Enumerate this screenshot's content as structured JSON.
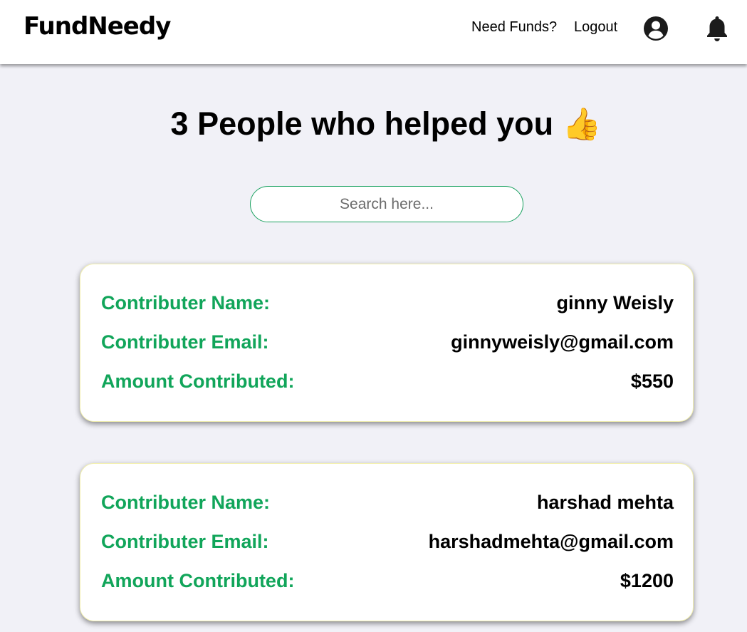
{
  "header": {
    "logo": "FundNeedy",
    "links": [
      "Need Funds?",
      "Logout"
    ],
    "icons": [
      "account-circle-icon",
      "bell-icon"
    ]
  },
  "main": {
    "title": "3 People who helped you",
    "title_emoji": "👍",
    "search": {
      "placeholder": "Search here...",
      "value": ""
    },
    "labels": {
      "name": "Contributer Name:",
      "email": "Contributer Email:",
      "amount": "Amount Contributed:"
    },
    "contributors": [
      {
        "name": "ginny Weisly",
        "email": "ginnyweisly@gmail.com",
        "amount": "$550"
      },
      {
        "name": "harshad mehta",
        "email": "harshadmehta@gmail.com",
        "amount": "$1200"
      }
    ]
  },
  "colors": {
    "accent_green": "#11a55a",
    "background": "#f1f1f7",
    "card_border": "#f3f0b0"
  }
}
